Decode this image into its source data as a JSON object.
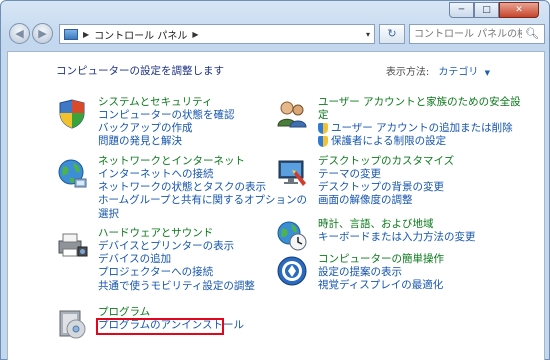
{
  "titlebar": {
    "minimize": "─",
    "maximize": "□",
    "close": "✕"
  },
  "nav": {
    "back": "◀",
    "forward": "▶",
    "breadcrumb": "コントロール パネル",
    "sep": "▶",
    "dropdown": "▾",
    "refresh": "↻",
    "search_placeholder": "コントロール パネルの検索",
    "search_icon": "magnifier-icon"
  },
  "main": {
    "heading": "コンピューターの設定を調整します",
    "view_by_label": "表示方法:",
    "view_by_value": "カテゴリ",
    "view_by_arrow": "▼"
  },
  "categories": [
    {
      "id": "system-security",
      "icon": "shield-check-icon",
      "title": "システムとセキュリティ",
      "links": [
        "コンピューターの状態を確認",
        "バックアップの作成",
        "問題の発見と解決"
      ]
    },
    {
      "id": "network-internet",
      "icon": "globe-network-icon",
      "title": "ネットワークとインターネット",
      "links": [
        "インターネットへの接続",
        "ネットワークの状態とタスクの表示",
        "ホームグループと共有に関するオプションの",
        "選択"
      ]
    },
    {
      "id": "hardware-sound",
      "icon": "printer-camera-icon",
      "title": "ハードウェアとサウンド",
      "links": [
        "デバイスとプリンターの表示",
        "デバイスの追加",
        "プロジェクターへの接続",
        "共通で使うモビリティ設定の調整"
      ]
    },
    {
      "id": "programs",
      "icon": "programs-disc-icon",
      "title": "プログラム",
      "links": [
        "プログラムのアンインストール"
      ]
    },
    {
      "id": "user-accounts",
      "icon": "users-icon",
      "title": "ユーザー アカウントと家族のための安全設",
      "title2": "定",
      "links": [
        "ユーザー アカウントの追加または削除",
        "保護者による制限の設定"
      ]
    },
    {
      "id": "appearance",
      "icon": "desktop-paint-icon",
      "title": "デスクトップのカスタマイズ",
      "links": [
        "テーマの変更",
        "デスクトップの背景の変更",
        "画面の解像度の調整"
      ]
    },
    {
      "id": "clock-region",
      "icon": "clock-globe-icon",
      "title": "時計、言語、および地域",
      "links": [
        "キーボードまたは入力方法の変更"
      ]
    },
    {
      "id": "ease-of-access",
      "icon": "ease-of-access-icon",
      "title": "コンピューターの簡単操作",
      "links": [
        "設定の提案の表示",
        "視覚ディスプレイの最適化"
      ]
    }
  ],
  "annotation": {
    "highlight_color": "#e3061a"
  }
}
